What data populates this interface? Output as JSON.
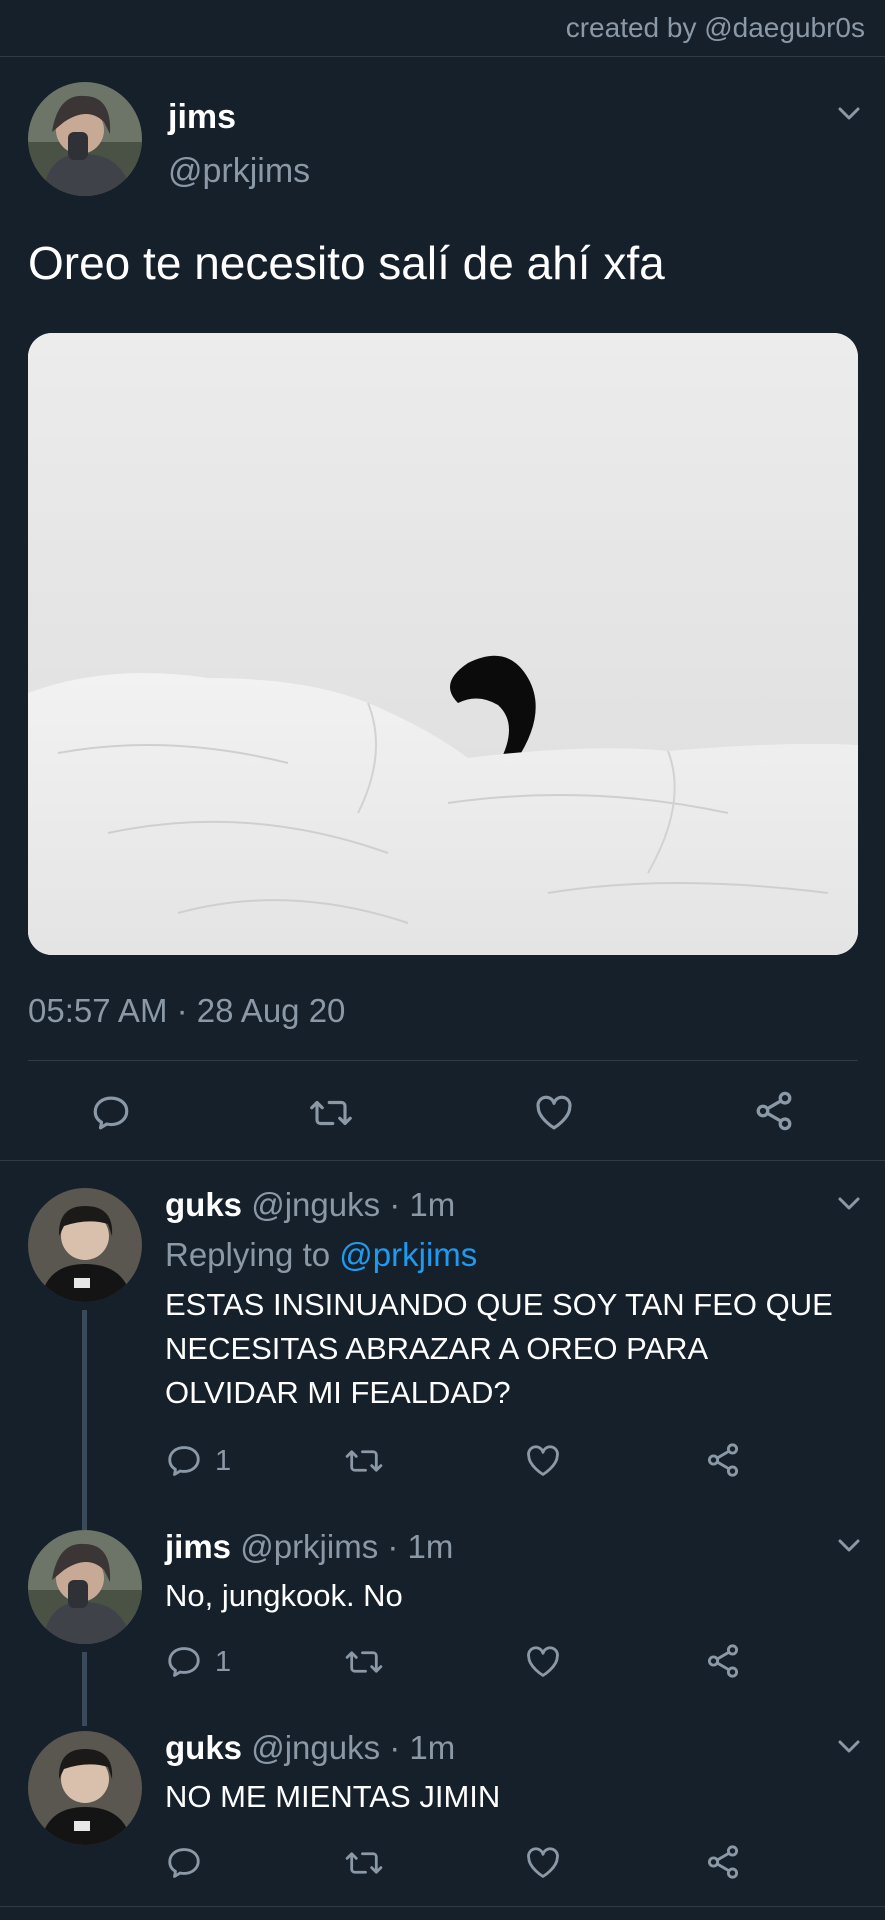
{
  "credit": "created by @daegubr0s",
  "main_tweet": {
    "name": "jims",
    "handle": "@prkjims",
    "text": "Oreo te necesito salí de ahí xfa",
    "timestamp": "05:57 AM · 28 Aug 20"
  },
  "replies": [
    {
      "name": "guks",
      "meta": "@jnguks · 1m",
      "replying_label": "Replying to",
      "replying_to": "@prkjims",
      "text": "ESTAS INSINUANDO QUE SOY TAN FEO QUE NECESITAS ABRAZAR A OREO PARA OLVIDAR MI FEALDAD?",
      "reply_count": "1"
    },
    {
      "name": "jims",
      "meta": "@prkjims · 1m",
      "text": "No, jungkook. No",
      "reply_count": "1"
    },
    {
      "name": "guks",
      "meta": "@jnguks · 1m",
      "text": "NO ME MIENTAS JIMIN",
      "reply_count": ""
    }
  ],
  "icons": {
    "reply": "reply-icon",
    "retweet": "retweet-icon",
    "like": "heart-icon",
    "share": "share-icon",
    "more": "chevron-down-icon"
  },
  "colors": {
    "background": "#15202b",
    "secondary_text": "#8b98a5",
    "link": "#1d9bf0"
  }
}
